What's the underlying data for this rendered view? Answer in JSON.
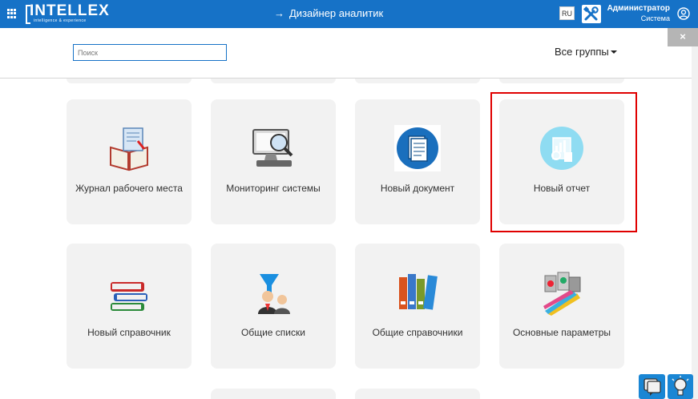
{
  "header": {
    "logo_text": "INTELLEX",
    "logo_sub": "intelligence & experience",
    "center_arrow": "→",
    "center_title": "Дизайнер аналитик",
    "lang": "RU",
    "admin_name": "Администратор",
    "admin_role": "Система",
    "icons": {
      "apps": "apps-grid-icon",
      "admin": "admin-tools-icon",
      "user": "user-circle-icon"
    }
  },
  "toolbar": {
    "search_placeholder": "Поиск",
    "groups_label": "Все группы",
    "close_label": "×"
  },
  "tiles": [
    {
      "label": "Журнал рабочего места",
      "icon": "journal-book-icon"
    },
    {
      "label": "Мониторинг системы",
      "icon": "monitor-magnifier-icon"
    },
    {
      "label": "Новый документ",
      "icon": "document-icon"
    },
    {
      "label": "Новый отчет",
      "icon": "report-chart-icon"
    },
    {
      "label": "Новый справочник",
      "icon": "books-stack-icon"
    },
    {
      "label": "Общие списки",
      "icon": "filter-users-icon"
    },
    {
      "label": "Общие справочники",
      "icon": "binders-icon"
    },
    {
      "label": "Основные параметры",
      "icon": "paint-cans-icon"
    }
  ],
  "footer_buttons": [
    {
      "icon": "chat-icon"
    },
    {
      "icon": "lightbulb-icon"
    }
  ],
  "colors": {
    "topbar": "#1672c7",
    "tile_bg": "#f2f2f2",
    "highlight": "#e00000"
  }
}
